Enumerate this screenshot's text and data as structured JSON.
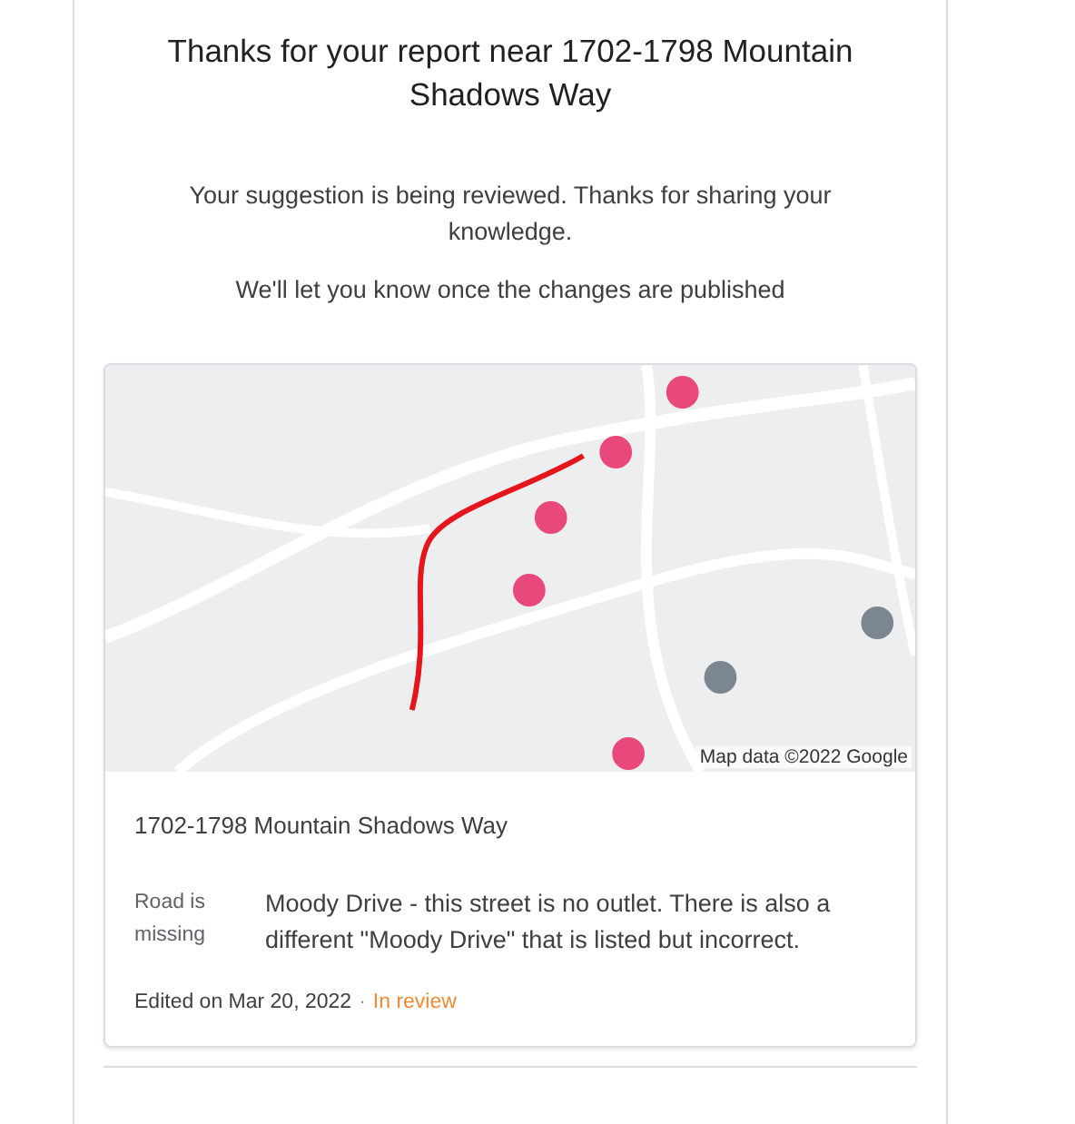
{
  "title": "Thanks for your report near 1702-1798 Mountain Shadows Way",
  "messages": [
    "Your suggestion is being reviewed. Thanks for sharing your knowledge.",
    "We'll let you know once the changes are published"
  ],
  "card": {
    "map": {
      "attribution": "Map data ©2022 Google"
    },
    "address": "1702-1798 Mountain Shadows Way",
    "issue_type": "Road is missing",
    "description": "Moody Drive - this street is no outlet. There is also a different \"Moody Drive\" that is listed but incorrect.",
    "edited": "Edited on Mar 20, 2022",
    "separator": "·",
    "status": {
      "kind": "in_review",
      "label": "In review"
    }
  }
}
